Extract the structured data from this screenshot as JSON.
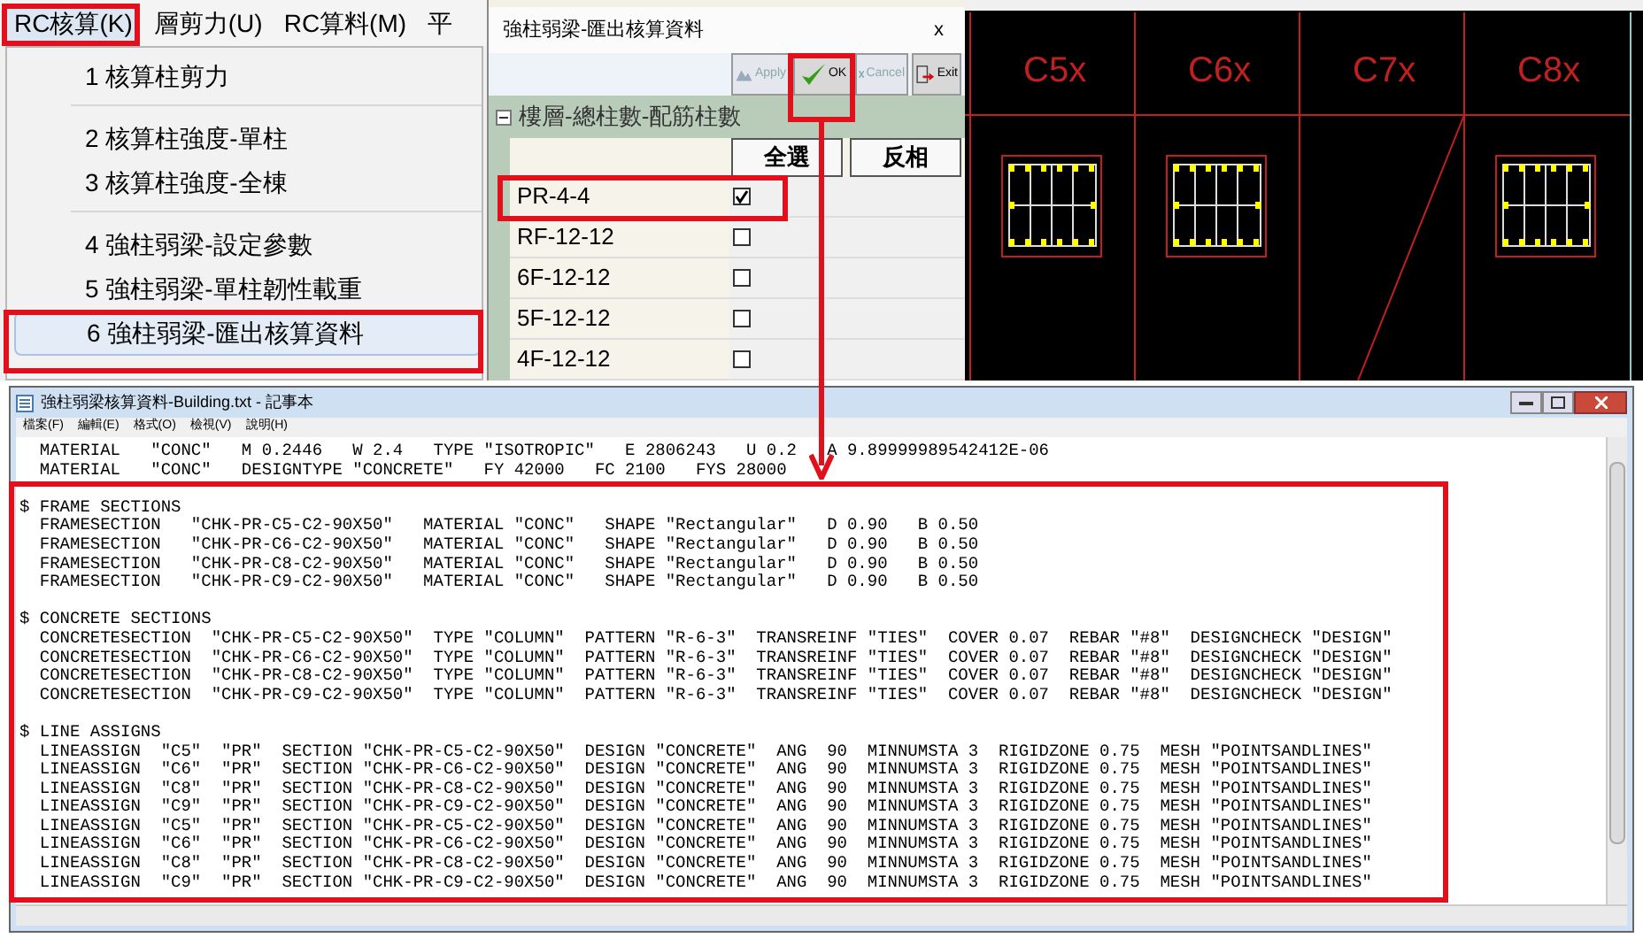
{
  "menu_bar": {
    "items": [
      {
        "label": "RC核算(K)",
        "selected": true
      },
      {
        "label": "層剪力(U)",
        "selected": false
      },
      {
        "label": "RC算料(M)",
        "selected": false
      },
      {
        "label": "平",
        "selected": false
      }
    ]
  },
  "dropdown": {
    "groups": [
      [
        {
          "label": "1 核算柱剪力",
          "selected": false
        }
      ],
      [
        {
          "label": "2 核算柱強度-單柱",
          "selected": false
        },
        {
          "label": "3 核算柱強度-全棟",
          "selected": false
        }
      ],
      [
        {
          "label": "4 強柱弱梁-設定參數",
          "selected": false
        },
        {
          "label": "5 強柱弱梁-單柱韌性載重",
          "selected": false
        },
        {
          "label": "6 強柱弱梁-匯出核算資料",
          "selected": true
        }
      ]
    ]
  },
  "dialog": {
    "title": "強柱弱梁-匯出核算資料",
    "close": "x",
    "toolbar": [
      {
        "kind": "apply",
        "label": "Apply",
        "disabled": true
      },
      {
        "kind": "ok",
        "label": "OK",
        "disabled": false
      },
      {
        "kind": "cancel",
        "label": "Cancel",
        "disabled": true
      },
      {
        "kind": "exit",
        "label": "Exit",
        "disabled": false
      }
    ],
    "group_title": "樓層-總柱數-配筋柱數",
    "expanded": true,
    "header_buttons": [
      "全選",
      "反相"
    ],
    "rows": [
      {
        "label": "PR-4-4",
        "checked": true
      },
      {
        "label": "RF-12-12",
        "checked": false
      },
      {
        "label": "6F-12-12",
        "checked": false
      },
      {
        "label": "5F-12-12",
        "checked": false
      },
      {
        "label": "4F-12-12",
        "checked": false
      }
    ]
  },
  "cad": {
    "columns": [
      {
        "label": "C5x",
        "kind": "section"
      },
      {
        "label": "C6x",
        "kind": "section"
      },
      {
        "label": "C7x",
        "kind": "diagonal"
      },
      {
        "label": "C8x",
        "kind": "section"
      }
    ]
  },
  "notepad": {
    "title": "強柱弱梁核算資料-Building.txt - 記事本",
    "menu": [
      "檔案(F)",
      "編輯(E)",
      "格式(O)",
      "檢視(V)",
      "說明(H)"
    ],
    "blocks": [
      {
        "lines": [
          "  MATERIAL   \"CONC\"   M 0.2446   W 2.4   TYPE \"ISOTROPIC\"   E 2806243   U 0.2   A 9.89999989542412E-06",
          "  MATERIAL   \"CONC\"   DESIGNTYPE \"CONCRETE\"   FY 42000   FC 2100   FYS 28000"
        ]
      },
      {
        "lines": [
          "$ FRAME SECTIONS",
          "  FRAMESECTION   \"CHK-PR-C5-C2-90X50\"   MATERIAL \"CONC\"   SHAPE \"Rectangular\"   D 0.90   B 0.50",
          "  FRAMESECTION   \"CHK-PR-C6-C2-90X50\"   MATERIAL \"CONC\"   SHAPE \"Rectangular\"   D 0.90   B 0.50",
          "  FRAMESECTION   \"CHK-PR-C8-C2-90X50\"   MATERIAL \"CONC\"   SHAPE \"Rectangular\"   D 0.90   B 0.50",
          "  FRAMESECTION   \"CHK-PR-C9-C2-90X50\"   MATERIAL \"CONC\"   SHAPE \"Rectangular\"   D 0.90   B 0.50"
        ]
      },
      {
        "lines": [
          "$ CONCRETE SECTIONS",
          "  CONCRETESECTION  \"CHK-PR-C5-C2-90X50\"  TYPE \"COLUMN\"  PATTERN \"R-6-3\"  TRANSREINF \"TIES\"  COVER 0.07  REBAR \"#8\"  DESIGNCHECK \"DESIGN\"",
          "  CONCRETESECTION  \"CHK-PR-C6-C2-90X50\"  TYPE \"COLUMN\"  PATTERN \"R-6-3\"  TRANSREINF \"TIES\"  COVER 0.07  REBAR \"#8\"  DESIGNCHECK \"DESIGN\"",
          "  CONCRETESECTION  \"CHK-PR-C8-C2-90X50\"  TYPE \"COLUMN\"  PATTERN \"R-6-3\"  TRANSREINF \"TIES\"  COVER 0.07  REBAR \"#8\"  DESIGNCHECK \"DESIGN\"",
          "  CONCRETESECTION  \"CHK-PR-C9-C2-90X50\"  TYPE \"COLUMN\"  PATTERN \"R-6-3\"  TRANSREINF \"TIES\"  COVER 0.07  REBAR \"#8\"  DESIGNCHECK \"DESIGN\""
        ]
      },
      {
        "lines": [
          "$ LINE ASSIGNS",
          "  LINEASSIGN  \"C5\"  \"PR\"  SECTION \"CHK-PR-C5-C2-90X50\"  DESIGN \"CONCRETE\"  ANG  90  MINNUMSTA 3  RIGIDZONE 0.75  MESH \"POINTSANDLINES\"",
          "  LINEASSIGN  \"C6\"  \"PR\"  SECTION \"CHK-PR-C6-C2-90X50\"  DESIGN \"CONCRETE\"  ANG  90  MINNUMSTA 3  RIGIDZONE 0.75  MESH \"POINTSANDLINES\"",
          "  LINEASSIGN  \"C8\"  \"PR\"  SECTION \"CHK-PR-C8-C2-90X50\"  DESIGN \"CONCRETE\"  ANG  90  MINNUMSTA 3  RIGIDZONE 0.75  MESH \"POINTSANDLINES\"",
          "  LINEASSIGN  \"C9\"  \"PR\"  SECTION \"CHK-PR-C9-C2-90X50\"  DESIGN \"CONCRETE\"  ANG  90  MINNUMSTA 3  RIGIDZONE 0.75  MESH \"POINTSANDLINES\"",
          "  LINEASSIGN  \"C5\"  \"PR\"  SECTION \"CHK-PR-C5-C2-90X50\"  DESIGN \"CONCRETE\"  ANG  90  MINNUMSTA 3  RIGIDZONE 0.75  MESH \"POINTSANDLINES\"",
          "  LINEASSIGN  \"C6\"  \"PR\"  SECTION \"CHK-PR-C6-C2-90X50\"  DESIGN \"CONCRETE\"  ANG  90  MINNUMSTA 3  RIGIDZONE 0.75  MESH \"POINTSANDLINES\"",
          "  LINEASSIGN  \"C8\"  \"PR\"  SECTION \"CHK-PR-C8-C2-90X50\"  DESIGN \"CONCRETE\"  ANG  90  MINNUMSTA 3  RIGIDZONE 0.75  MESH \"POINTSANDLINES\"",
          "  LINEASSIGN  \"C9\"  \"PR\"  SECTION \"CHK-PR-C9-C2-90X50\"  DESIGN \"CONCRETE\"  ANG  90  MINNUMSTA 3  RIGIDZONE 0.75  MESH \"POINTSANDLINES\""
        ]
      }
    ]
  }
}
